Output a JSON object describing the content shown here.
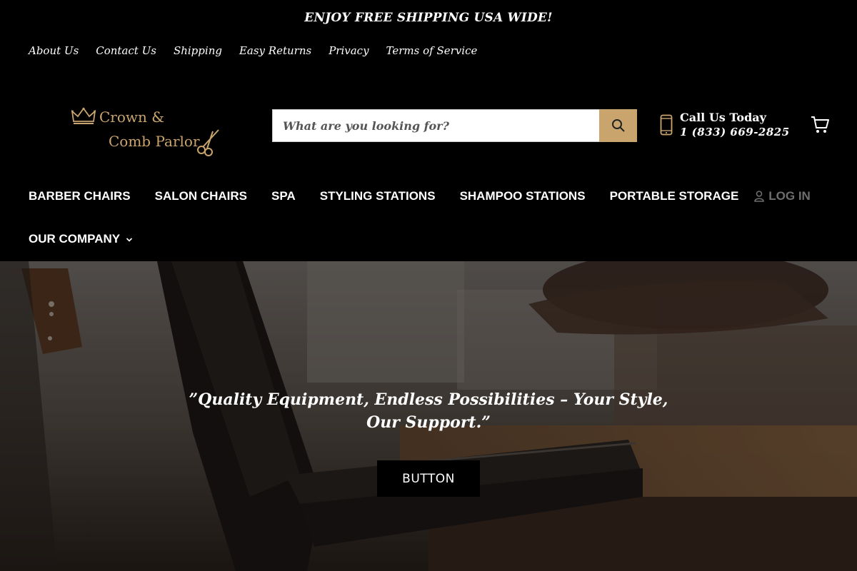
{
  "announcement": "ENJOY FREE SHIPPING USA WIDE!",
  "utility_links": [
    "About Us",
    "Contact Us",
    "Shipping",
    "Easy Returns",
    "Privacy",
    "Terms of Service"
  ],
  "logo": {
    "line1": "Crown &",
    "line2": "Comb Parlor"
  },
  "search": {
    "placeholder": "What are you looking for?"
  },
  "call": {
    "title": "Call Us Today",
    "number": "1 (833) 669-2825"
  },
  "nav": {
    "items": [
      "BARBER CHAIRS",
      "SALON CHAIRS",
      "SPA",
      "STYLING STATIONS",
      "SHAMPOO STATIONS",
      "PORTABLE STORAGE"
    ],
    "login": "LOG IN",
    "company": "OUR COMPANY"
  },
  "hero": {
    "tagline": "”Quality Equipment, Endless Possibilities – Your Style, Our Support.”",
    "button": "BUTTON"
  },
  "colors": {
    "accent": "#c9a46c",
    "background": "#000000"
  },
  "icons": [
    "crown-icon",
    "scissors-icon",
    "search-icon",
    "phone-icon",
    "cart-icon",
    "user-icon",
    "chevron-down-icon"
  ]
}
